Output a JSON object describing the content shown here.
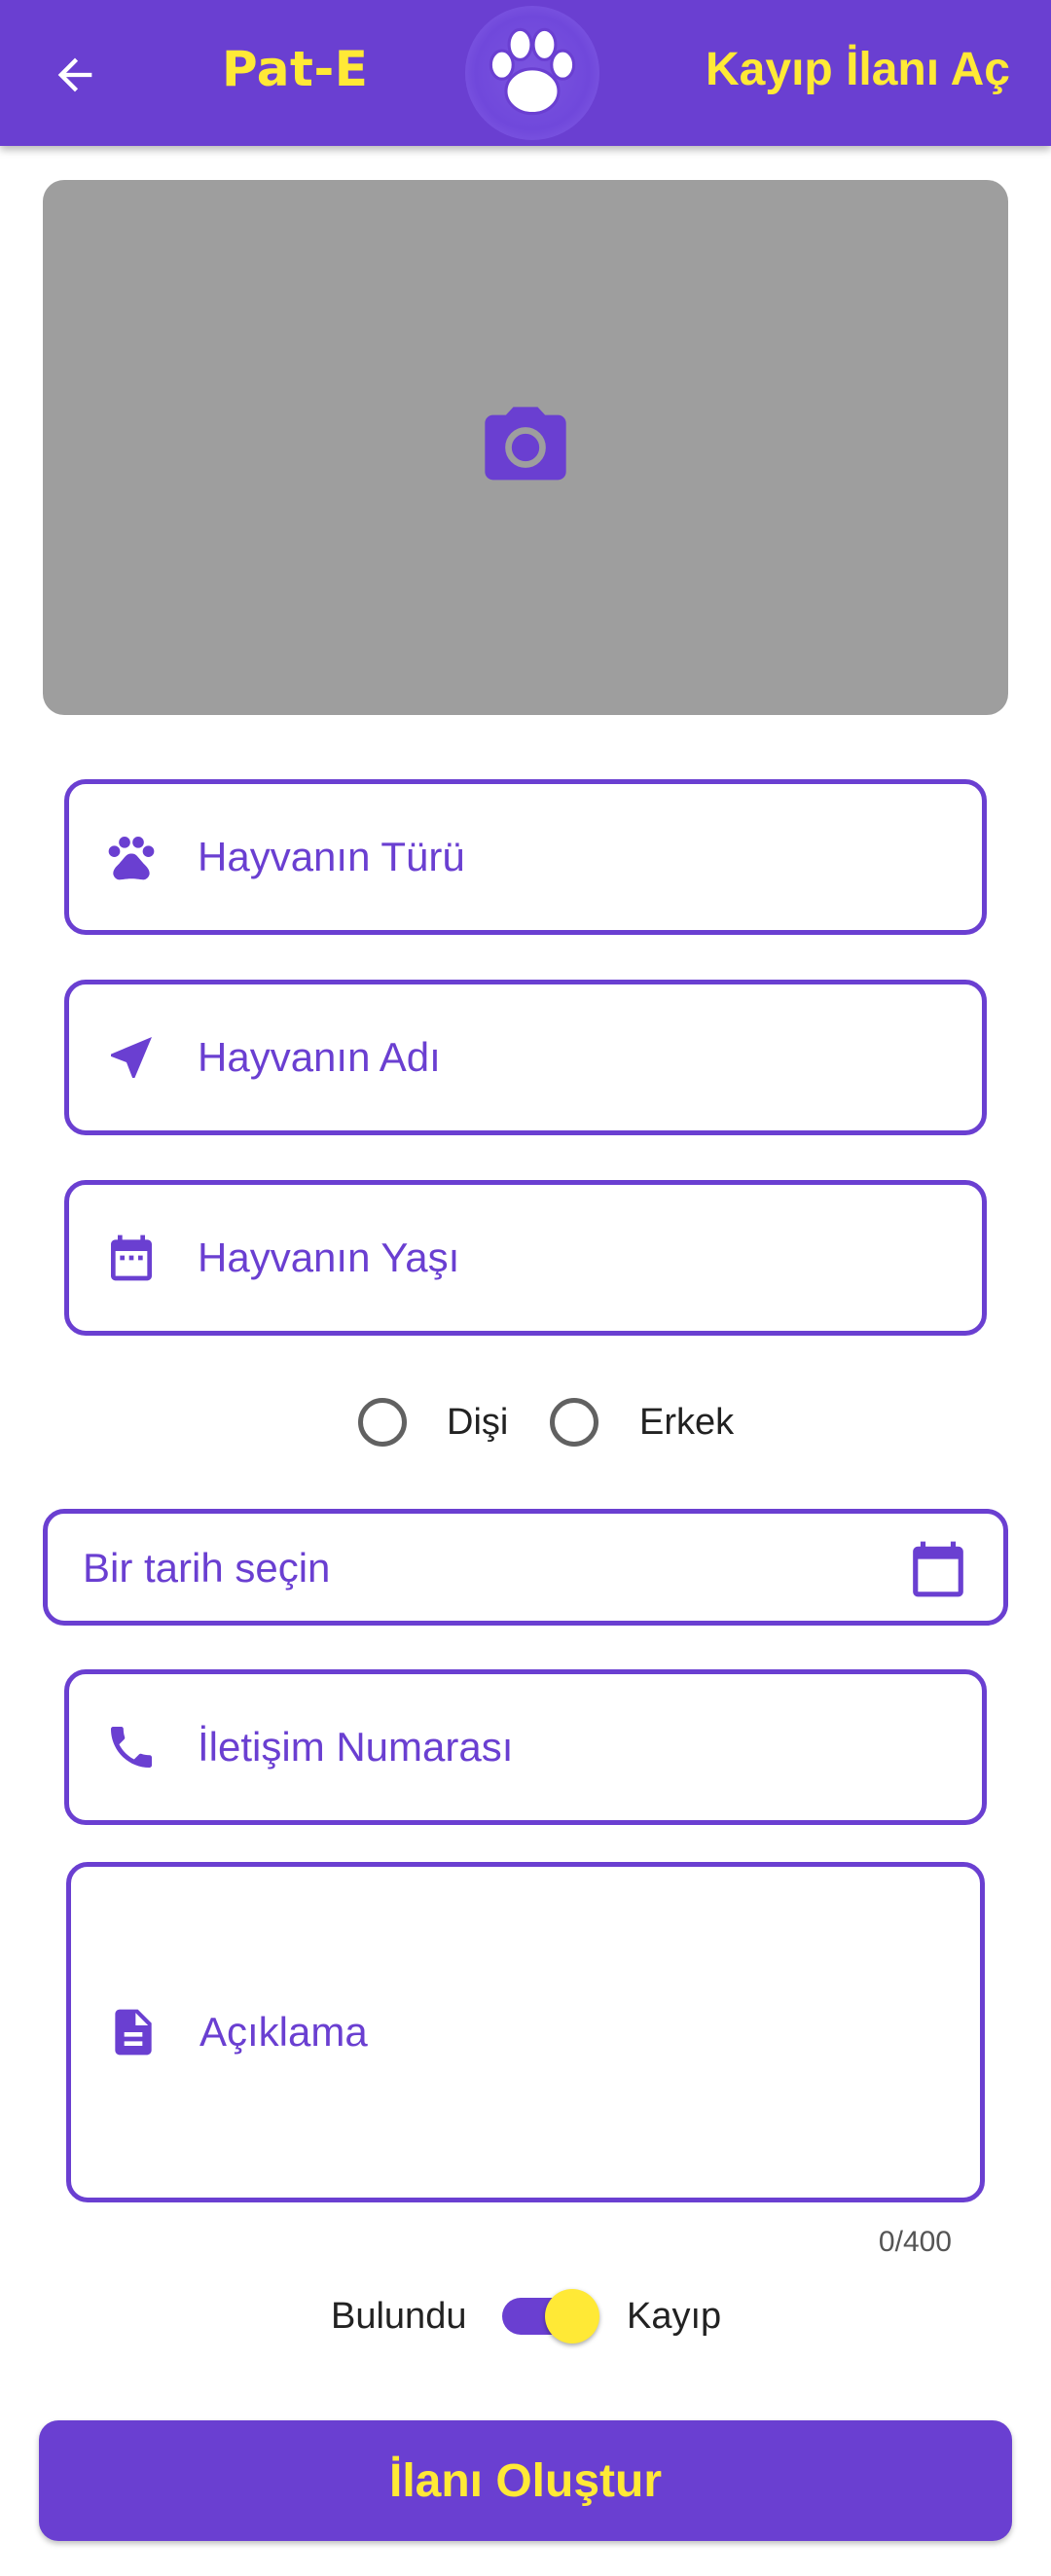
{
  "header": {
    "brand": "Pat-E",
    "title": "Kayıp İlanı Aç",
    "back_icon": "arrow-back-icon",
    "logo_icon": "paw-logo-icon"
  },
  "photo": {
    "icon": "camera-icon"
  },
  "form": {
    "animal_type": {
      "placeholder": "Hayvanın Türü",
      "icon": "paw-icon"
    },
    "animal_name": {
      "placeholder": "Hayvanın Adı",
      "icon": "navigation-arrow-icon"
    },
    "animal_age": {
      "placeholder": "Hayvanın Yaşı",
      "icon": "calendar-icon"
    },
    "gender": {
      "options": [
        "Dişi",
        "Erkek"
      ],
      "selected": null
    },
    "date": {
      "placeholder": "Bir tarih seçin",
      "icon": "calendar-icon"
    },
    "phone": {
      "placeholder": "İletişim Numarası",
      "icon": "phone-icon"
    },
    "description": {
      "placeholder": "Açıklama",
      "icon": "document-icon",
      "counter": "0/400"
    },
    "status_toggle": {
      "left_label": "Bulundu",
      "right_label": "Kayıp",
      "checked": true
    },
    "submit_label": "İlanı Oluştur"
  },
  "colors": {
    "primary": "#6a3fd1",
    "accent": "#ffe936",
    "photo_placeholder": "#9e9e9e"
  }
}
